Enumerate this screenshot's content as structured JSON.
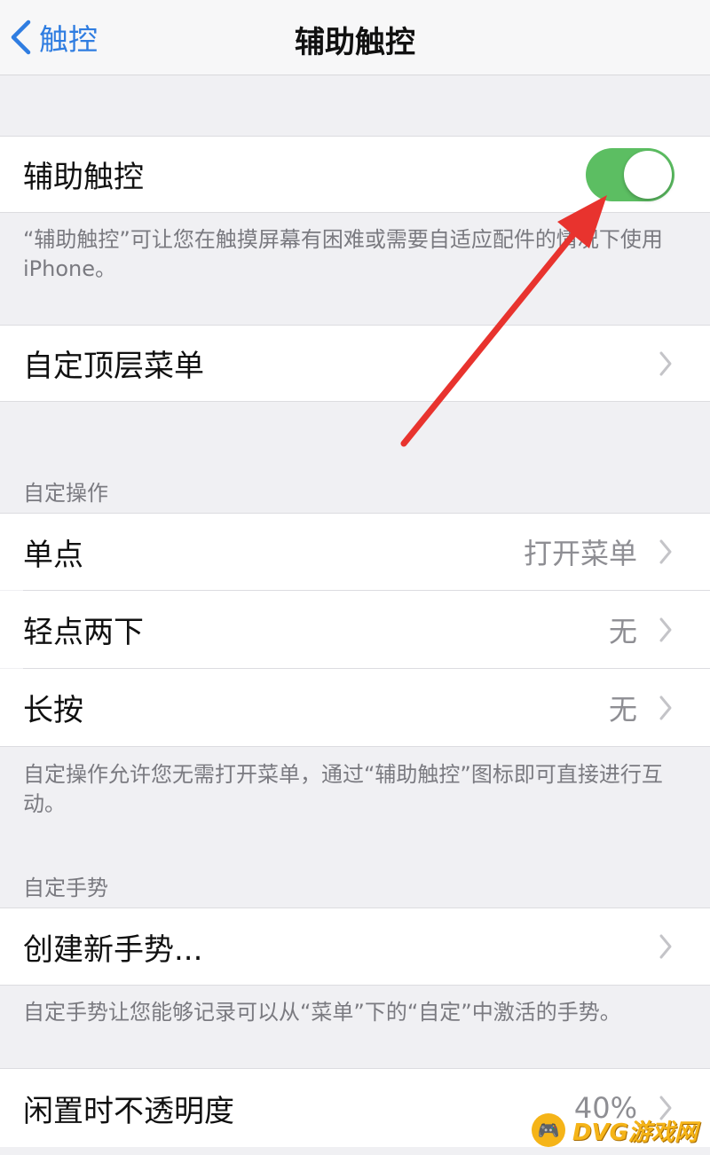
{
  "nav": {
    "back_label": "触控",
    "title": "辅助触控"
  },
  "assistive_touch": {
    "label": "辅助触控",
    "enabled": true,
    "note": "“辅助触控”可让您在触摸屏幕有困难或需要自适应配件的情况下使用iPhone。"
  },
  "top_menu": {
    "label": "自定顶层菜单"
  },
  "custom_actions": {
    "header": "自定操作",
    "rows": [
      {
        "label": "单点",
        "value": "打开菜单"
      },
      {
        "label": "轻点两下",
        "value": "无"
      },
      {
        "label": "长按",
        "value": "无"
      }
    ],
    "note": "自定操作允许您无需打开菜单，通过“辅助触控”图标即可直接进行互动。"
  },
  "custom_gestures": {
    "header": "自定手势",
    "create_label": "创建新手势...",
    "note": "自定手势让您能够记录可以从“菜单”下的“自定”中激活的手势。"
  },
  "idle_opacity": {
    "label": "闲置时不透明度",
    "value": "40%"
  },
  "watermark": {
    "text": "DVG游戏网"
  },
  "colors": {
    "accent": "#2f7de1",
    "toggle_on": "#5cbe62",
    "annotation_arrow": "#e8332e",
    "background": "#f0f0f3"
  }
}
